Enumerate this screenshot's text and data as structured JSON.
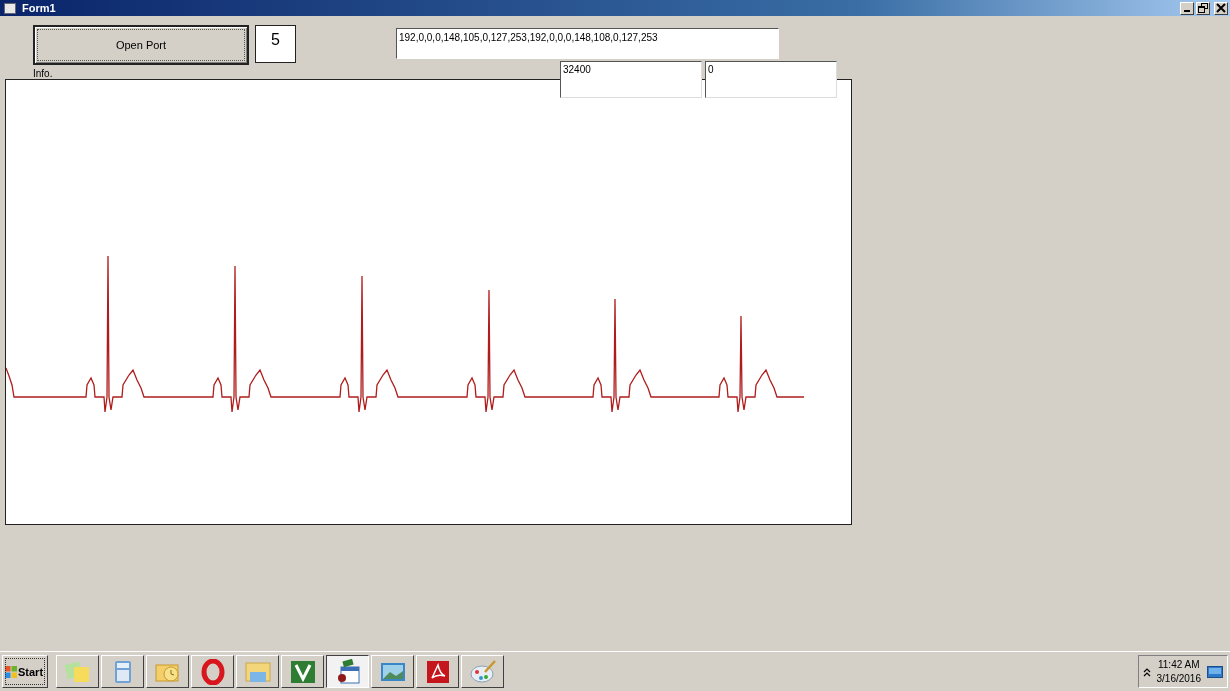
{
  "window": {
    "title": "Form1"
  },
  "open_port_button": {
    "label": "Open Port"
  },
  "count_display": "5",
  "data_field": {
    "value": "192,0,0,0,148,105,0,127,253,192,0,0,0,148,108,0,127,253"
  },
  "info_label": "Info.",
  "value_fields": [
    {
      "value": "32400"
    },
    {
      "value": "0"
    }
  ],
  "taskbar": {
    "start_label": "Start",
    "buttons": [
      {
        "selected": false
      },
      {
        "selected": false
      },
      {
        "selected": false
      },
      {
        "selected": false
      },
      {
        "selected": false
      },
      {
        "selected": false
      },
      {
        "selected": true
      },
      {
        "selected": false
      },
      {
        "selected": false
      },
      {
        "selected": false
      }
    ],
    "clock": {
      "time": "11:42 AM",
      "date": "3/16/2016"
    }
  }
}
